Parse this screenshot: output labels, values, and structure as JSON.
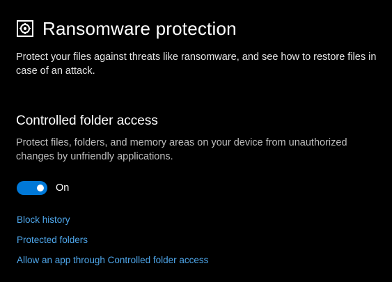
{
  "header": {
    "title": "Ransomware protection",
    "icon": "ransomware-shield-icon"
  },
  "description": "Protect your files against threats like ransomware, and see how to restore files in case of an attack.",
  "controlled_folder_access": {
    "title": "Controlled folder access",
    "description": "Protect files, folders, and memory areas on your device from unauthorized changes by unfriendly applications.",
    "toggle_state": "On",
    "toggle_on": true,
    "accent_color": "#0078d7"
  },
  "links": [
    {
      "label": "Block history"
    },
    {
      "label": "Protected folders"
    },
    {
      "label": "Allow an app through Controlled folder access"
    }
  ],
  "colors": {
    "background": "#000000",
    "link": "#4ea6ea"
  }
}
